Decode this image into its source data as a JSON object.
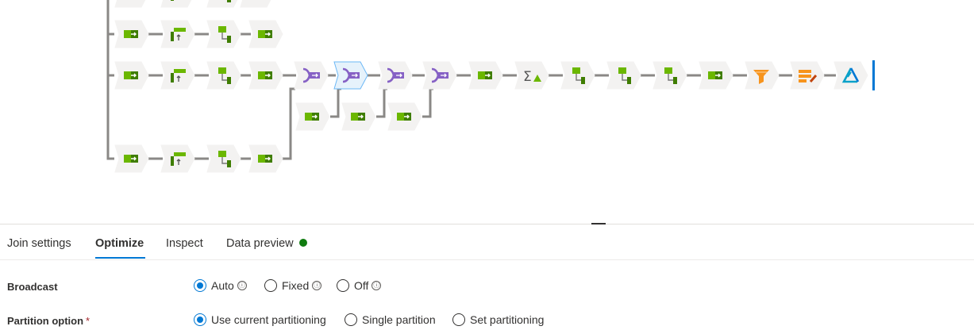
{
  "flow": {
    "nodes": [
      {
        "icon": "select-icon",
        "selected": false
      },
      {
        "icon": "derived-column-icon",
        "selected": false
      },
      {
        "icon": "conditional-split-icon",
        "selected": false
      },
      {
        "icon": "join-icon",
        "selected": false
      },
      {
        "icon": "join-icon",
        "selected": true
      },
      {
        "icon": "aggregate-icon",
        "selected": false
      },
      {
        "icon": "filter-icon",
        "selected": false
      },
      {
        "icon": "alter-row-icon",
        "selected": false
      },
      {
        "icon": "sink-icon",
        "selected": false
      }
    ]
  },
  "tabs": [
    {
      "label": "Join settings",
      "active": false
    },
    {
      "label": "Optimize",
      "active": true
    },
    {
      "label": "Inspect",
      "active": false
    },
    {
      "label": "Data preview",
      "active": false,
      "status_color": "#107c10"
    }
  ],
  "broadcast": {
    "label": "Broadcast",
    "options": [
      {
        "label": "Auto",
        "selected": true,
        "info": "ⓘ"
      },
      {
        "label": "Fixed",
        "selected": false,
        "info": "ⓘ"
      },
      {
        "label": "Off",
        "selected": false,
        "info": "ⓘ"
      }
    ]
  },
  "partition": {
    "label": "Partition option",
    "required_mark": "*",
    "options": [
      {
        "label": "Use current partitioning",
        "selected": true
      },
      {
        "label": "Single partition",
        "selected": false
      },
      {
        "label": "Set partitioning",
        "selected": false
      }
    ]
  },
  "colors": {
    "accent": "#0078d4",
    "node_bg": "#f3f2f1",
    "connector": "#8a8886",
    "green_icon": "#6bb700",
    "join_purple": "#8661c5",
    "orange_icon": "#f7941d"
  }
}
